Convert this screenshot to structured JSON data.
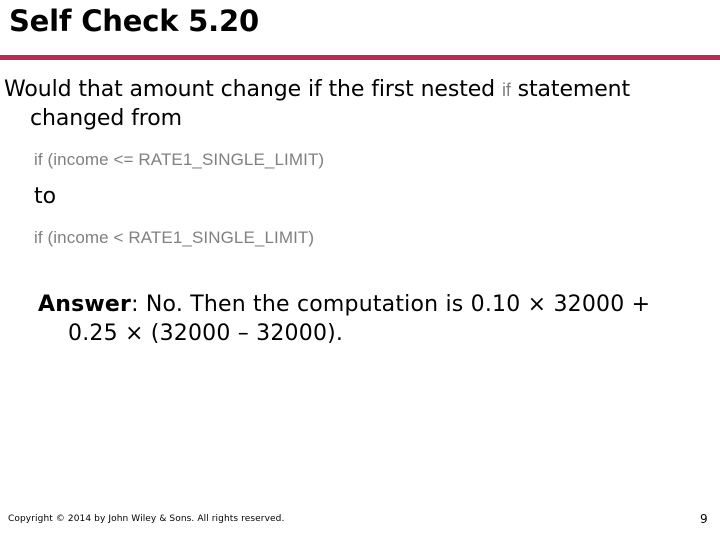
{
  "slide": {
    "title": "Self Check 5.20",
    "accent_color": "#b72b55",
    "question": {
      "line1": "Would that amount change if the first nested ",
      "inline_code": "if",
      "line1_tail": " statement",
      "line2": "changed from"
    },
    "code_before": "if (income <= RATE1_SINGLE_LIMIT)",
    "connector": "to",
    "code_after": "if (income < RATE1_SINGLE_LIMIT)",
    "answer": {
      "label": "Answer",
      "line1": ": No. Then the computation is 0.10 × 32000 +",
      "line2": "0.25 × (32000 – 32000)."
    },
    "footer": {
      "copyright": "Copyright © 2014 by John Wiley & Sons.  All rights reserved.",
      "page_number": "9"
    }
  }
}
